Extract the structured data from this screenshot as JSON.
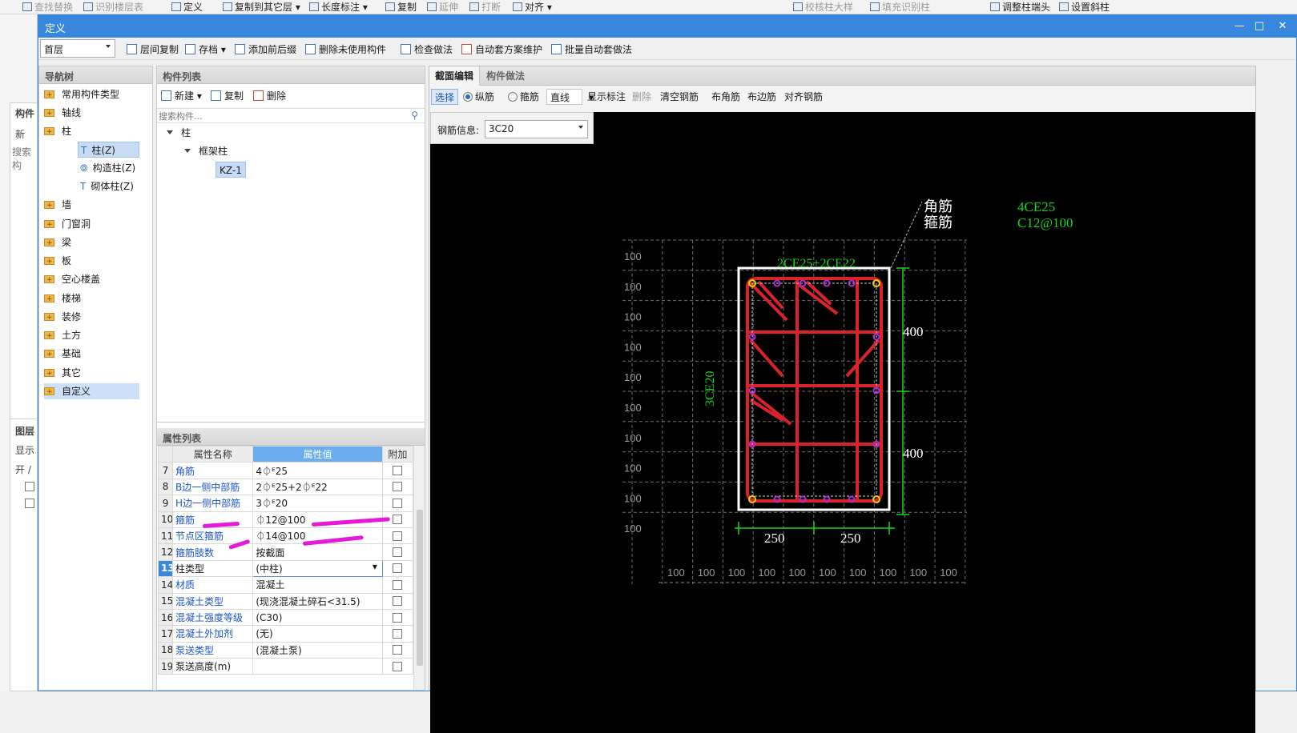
{
  "ribbon": [
    "查找替换",
    "识别楼层表",
    "定义",
    "复制到其它层",
    "长度标注",
    "复制",
    "延伸",
    "打断",
    "对齐",
    "校核柱大样",
    "填充识别柱",
    "调整柱端头",
    "设置斜柱"
  ],
  "left_bg": {
    "items": [
      "构件",
      "新",
      "搜索构",
      "图层",
      "显示",
      "开 /"
    ]
  },
  "window": {
    "title": "定义",
    "min": "—",
    "max": "□",
    "close": "✕"
  },
  "toolbar": {
    "floor": "首层",
    "items": [
      "层间复制",
      "存档",
      "添加前后缀",
      "删除未使用构件",
      "检查做法",
      "自动套方案维护",
      "批量自动套做法"
    ]
  },
  "nav_tree": {
    "title": "导航树",
    "items": [
      "常用构件类型",
      "轴线",
      "柱",
      "墙",
      "门窗洞",
      "梁",
      "板",
      "空心楼盖",
      "楼梯",
      "装修",
      "土方",
      "基础",
      "其它",
      "自定义"
    ],
    "children": [
      "柱(Z)",
      "构造柱(Z)",
      "砌体柱(Z)"
    ]
  },
  "comp_list": {
    "title": "构件列表",
    "new": "新建",
    "copy": "复制",
    "delete": "删除",
    "search_placeholder": "搜索构件...",
    "tree": [
      "柱",
      "框架柱",
      "KZ-1"
    ]
  },
  "props": {
    "title": "属性列表",
    "headers": [
      "属性名称",
      "属性值",
      "附加"
    ],
    "rows": [
      {
        "n": "7",
        "name": "角筋",
        "value": "4⏀ᴱ25"
      },
      {
        "n": "8",
        "name": "B边一侧中部筋",
        "value": "2⏀ᴱ25+2⏀ᴱ22"
      },
      {
        "n": "9",
        "name": "H边一侧中部筋",
        "value": "3⏀ᴱ20"
      },
      {
        "n": "10",
        "name": "箍筋",
        "value": "⏀12@100"
      },
      {
        "n": "11",
        "name": "节点区箍筋",
        "value": "⏀14@100"
      },
      {
        "n": "12",
        "name": "箍筋肢数",
        "value": "按截面"
      },
      {
        "n": "13",
        "name": "柱类型",
        "value": "(中柱)"
      },
      {
        "n": "14",
        "name": "材质",
        "value": "混凝土"
      },
      {
        "n": "15",
        "name": "混凝土类型",
        "value": "(现浇混凝土碎石<31.5)"
      },
      {
        "n": "16",
        "name": "混凝土强度等级",
        "value": "(C30)"
      },
      {
        "n": "17",
        "name": "混凝土外加剂",
        "value": "(无)"
      },
      {
        "n": "18",
        "name": "泵送类型",
        "value": "(混凝土泵)"
      },
      {
        "n": "19",
        "name": "泵送高度(m)",
        "value": ""
      }
    ]
  },
  "editor": {
    "tabs": [
      "截面编辑",
      "构件做法"
    ],
    "tools": [
      "选择",
      "纵筋",
      "箍筋",
      "直线",
      "显示标注",
      "删除",
      "清空钢筋",
      "布角筋",
      "布边筋",
      "对齐钢筋"
    ],
    "rebar_info_label": "钢筋信息:",
    "rebar_info_value": "3C20"
  },
  "drawing": {
    "legend_labels": [
      "角筋",
      "箍筋"
    ],
    "legend_values": [
      "4CE25",
      "C12@100"
    ],
    "top_rebar": "2CE25+2CE22",
    "side_rebar": "3CE20",
    "dim_h": [
      "400",
      "400"
    ],
    "dim_b": [
      "250",
      "250"
    ],
    "grid_label": "100",
    "colors": {
      "bg": "#000000",
      "stirrup": "#d8222c",
      "text_green": "#19d619",
      "grid": "#6e6e6e",
      "bar_dot": "#b32bd6"
    }
  }
}
